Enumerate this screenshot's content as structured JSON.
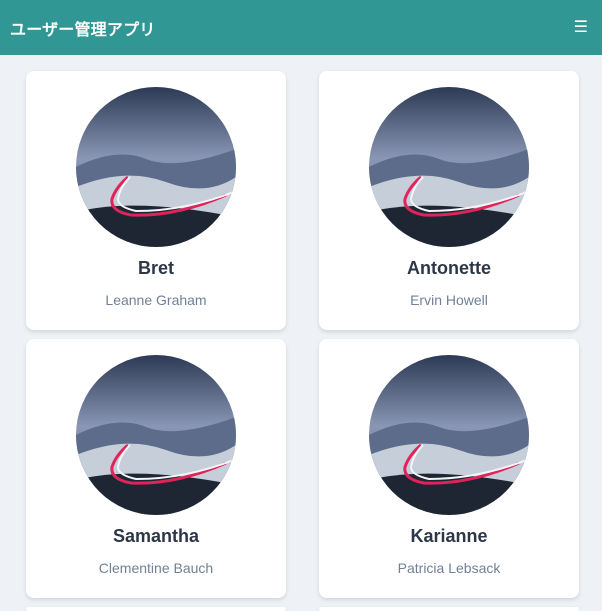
{
  "app": {
    "title": "ユーザー管理アプリ",
    "menu_icon": "hamburger-menu-icon",
    "accent": "#319795",
    "background": "#eef2f6"
  },
  "users": [
    {
      "username": "Bret",
      "name": "Leanne Graham"
    },
    {
      "username": "Antonette",
      "name": "Ervin Howell"
    },
    {
      "username": "Samantha",
      "name": "Clementine Bauch"
    },
    {
      "username": "Karianne",
      "name": "Patricia Lebsack"
    }
  ]
}
